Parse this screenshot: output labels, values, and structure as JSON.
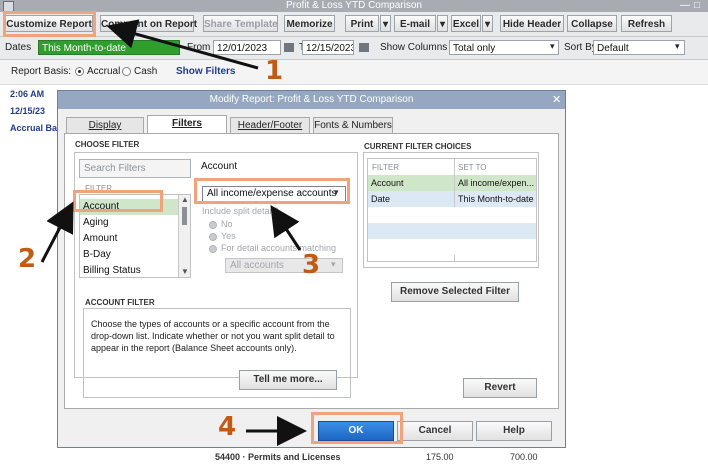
{
  "window": {
    "title": "Profit & Loss YTD Comparison"
  },
  "toolbar": {
    "customize": "Customize Report",
    "comment": "Comment on Report",
    "share": "Share Template",
    "memorize": "Memorize",
    "print": "Print",
    "email": "E-mail",
    "excel": "Excel",
    "hide_header": "Hide Header",
    "collapse": "Collapse",
    "refresh": "Refresh"
  },
  "filters": {
    "dates_label": "Dates",
    "dates_value": "This Month-to-date",
    "from_label": "From",
    "from_value": "12/01/2023",
    "to_label": "To",
    "to_value": "12/15/2023",
    "show_columns_label": "Show Columns",
    "show_columns_value": "Total only",
    "sort_by_label": "Sort By",
    "sort_by_value": "Default"
  },
  "basis": {
    "label": "Report Basis:",
    "accrual": "Accrual",
    "cash": "Cash",
    "selected": "Accrual",
    "show_filters": "Show Filters"
  },
  "report_header": {
    "time": "2:06 AM",
    "date": "12/15/23",
    "basis": "Accrual Bas"
  },
  "report_footer": {
    "account_row": "54400 · Permits and Licenses",
    "value1": "175.00",
    "value2": "700.00"
  },
  "modal": {
    "title": "Modify Report: Profit & Loss YTD Comparison",
    "tabs": [
      "Display",
      "Filters",
      "Header/Footer",
      "Fonts & Numbers"
    ],
    "active_tab": "Filters",
    "choose_filter_title": "CHOOSE FILTER",
    "search_placeholder": "Search Filters",
    "selected_filter_name": "Account",
    "filter_list_header": "FILTER",
    "filter_list": [
      "Account",
      "Aging",
      "Amount",
      "B-Day",
      "Billing Status"
    ],
    "account_dropdown": "All income/expense accounts",
    "include_split": "Include split detail?",
    "split_no": "No",
    "split_yes": "Yes",
    "split_detail": "For detail accounts matching",
    "all_accounts": "All accounts",
    "account_filter_title": "ACCOUNT FILTER",
    "account_filter_desc": "Choose the types of accounts or a specific account from the drop-down list. Indicate whether or not you want split detail to appear in the report (Balance Sheet accounts only).",
    "tell_me_more": "Tell me more...",
    "current_choices_title": "CURRENT FILTER CHOICES",
    "col_filter": "FILTER",
    "col_set_to": "SET TO",
    "choices": [
      {
        "filter": "Account",
        "set_to": "All income/expen..."
      },
      {
        "filter": "Date",
        "set_to": "This Month-to-date"
      }
    ],
    "remove_button": "Remove Selected Filter",
    "revert_button": "Revert",
    "ok_button": "OK",
    "cancel_button": "Cancel",
    "help_button": "Help"
  },
  "annotations": {
    "step1": "1",
    "step2": "2",
    "step3": "3",
    "step4": "4",
    "highlight_color": "#f1a47c",
    "number_color": "#c35a14"
  }
}
